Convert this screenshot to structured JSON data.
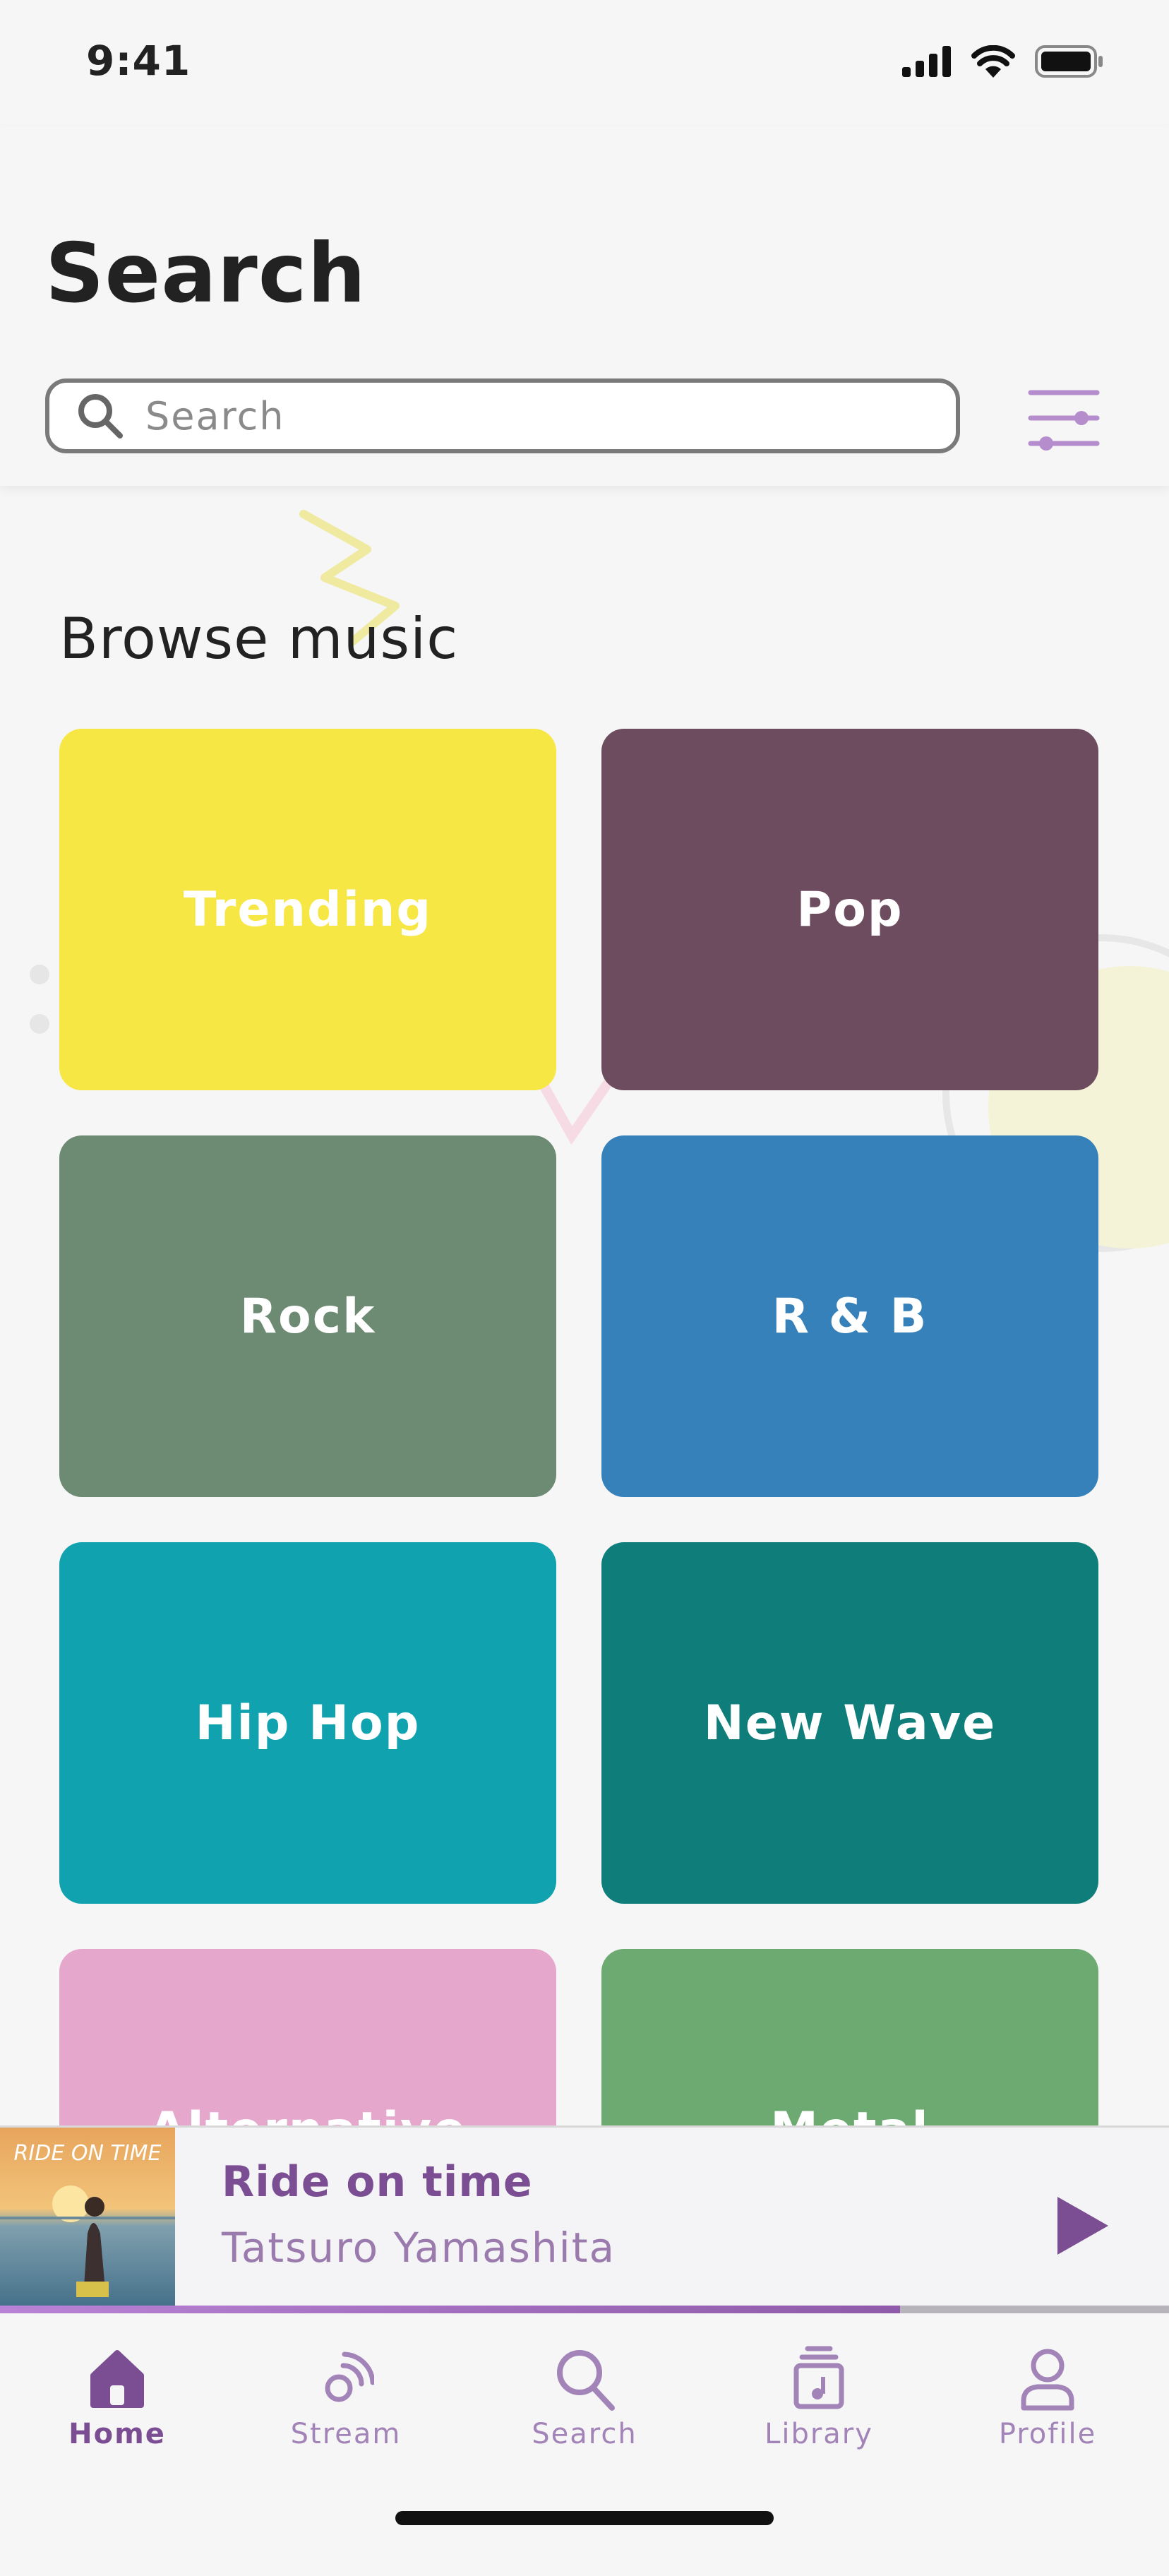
{
  "status_bar": {
    "time": "9:41"
  },
  "header": {
    "title": "Search",
    "search": {
      "value": "",
      "placeholder": "Search"
    }
  },
  "browse": {
    "title": "Browse music",
    "categories": [
      {
        "label": "Trending",
        "color": "#f7e744"
      },
      {
        "label": "Pop",
        "color": "#6d4c5f"
      },
      {
        "label": "Rock",
        "color": "#6c8b72"
      },
      {
        "label": "R & B",
        "color": "#3781ba"
      },
      {
        "label": "Hip Hop",
        "color": "#11a2b0"
      },
      {
        "label": "New Wave",
        "color": "#0f7d7a"
      },
      {
        "label": "Alternative",
        "color": "#e5a8cc"
      },
      {
        "label": "Metal",
        "color": "#6daa72"
      }
    ]
  },
  "now_playing": {
    "title": "Ride on time",
    "artist": "Tatsuro Yamashita",
    "album_art_text": "RIDE ON TIME",
    "progress": 0.77
  },
  "tab_bar": {
    "tabs": [
      {
        "label": "Home",
        "icon": "home-icon",
        "active": true
      },
      {
        "label": "Stream",
        "icon": "stream-icon",
        "active": false
      },
      {
        "label": "Search",
        "icon": "search-icon",
        "active": false
      },
      {
        "label": "Library",
        "icon": "library-icon",
        "active": false
      },
      {
        "label": "Profile",
        "icon": "profile-icon",
        "active": false
      }
    ]
  },
  "colors": {
    "accent": "#7b4d93",
    "accent_light": "#a384b8",
    "progress": "#b883d6"
  }
}
